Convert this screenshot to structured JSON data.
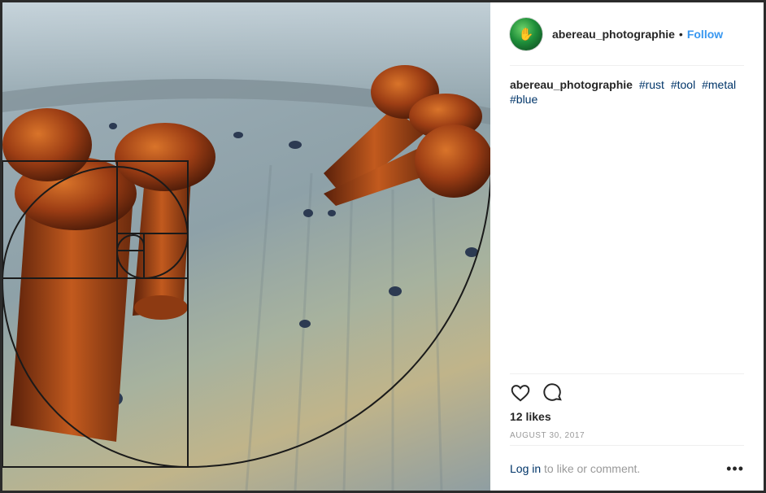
{
  "post": {
    "username": "abereau_photographie",
    "separator": "•",
    "follow_label": "Follow",
    "caption_user": "abereau_photographie",
    "hashtags": [
      "#rust",
      "#tool",
      "#metal",
      "#blue"
    ],
    "likes": "12 likes",
    "date": "AUGUST 30, 2017",
    "login_link": "Log in",
    "login_suffix": " to like or comment.",
    "more_label": "•••"
  },
  "icons": {
    "avatar": "avatar-image",
    "like": "heart-icon",
    "comment": "comment-icon",
    "more": "more-options-icon"
  },
  "colors": {
    "accent": "#3897f0",
    "hashtag": "#003569",
    "text": "#262626",
    "muted": "#999999"
  }
}
